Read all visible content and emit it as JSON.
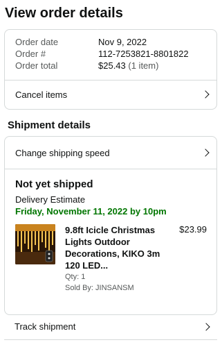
{
  "page": {
    "title": "View order details"
  },
  "order": {
    "rows": [
      {
        "label": "Order date",
        "value": "Nov 9, 2022"
      },
      {
        "label": "Order #",
        "value": "112-7253821-8801822"
      },
      {
        "label": "Order total",
        "value": "$25.43",
        "note": "(1 item)"
      }
    ],
    "cancel_label": "Cancel items"
  },
  "shipment": {
    "section_title": "Shipment details",
    "change_speed_label": "Change shipping speed",
    "status": "Not yet shipped",
    "delivery_label": "Delivery Estimate",
    "delivery_date": "Friday, November 11, 2022 by 10pm",
    "item": {
      "title": "9.8ft Icicle Christmas Lights Outdoor Decorations, KIKO 3m 120 LED...",
      "price": "$23.99",
      "qty": "Qty: 1",
      "sold_by": "Sold By: JINSANSM"
    },
    "track_label": "Track shipment"
  },
  "icons": {
    "chevron": "chevron-right-icon"
  },
  "colors": {
    "delivery_green": "#007600",
    "border": "#d5d9d9",
    "muted": "#565959"
  }
}
